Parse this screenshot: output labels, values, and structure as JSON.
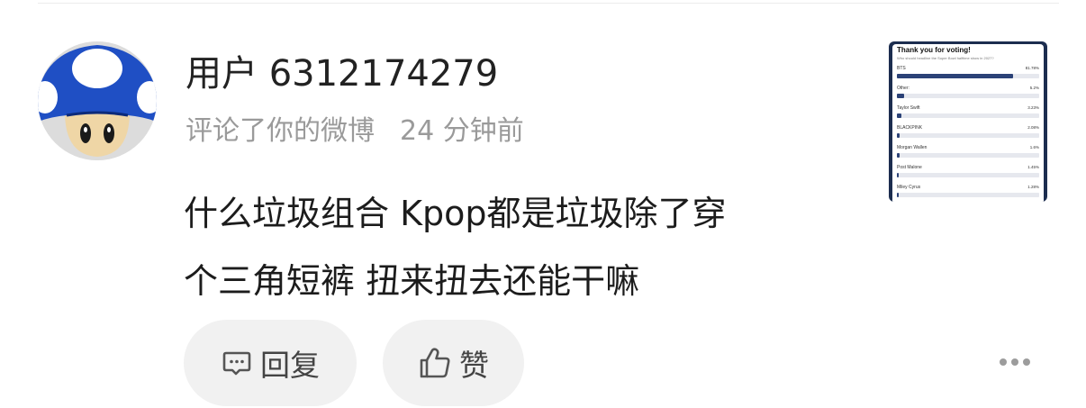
{
  "comment": {
    "username": "用户 6312174279",
    "action": "评论了你的微博",
    "time": "24 分钟前",
    "lines": [
      "什么垃圾组合 Kpop都是垃圾除了穿",
      "个三角短裤 扭来扭去还能干嘛"
    ]
  },
  "thumbnail": {
    "title": "Thank you for voting!",
    "subtitle": "Who should headline the Super Bowl halftime show in 2027?",
    "poll": [
      {
        "name": "BTS",
        "percent": "81.78%",
        "value": 81.78
      },
      {
        "name": "Other:",
        "percent": "5.2%",
        "value": 5.2
      },
      {
        "name": "Taylor Swift",
        "percent": "3.23%",
        "value": 3.23
      },
      {
        "name": "BLACKPINK",
        "percent": "2.08%",
        "value": 2.08
      },
      {
        "name": "Morgan Wallen",
        "percent": "1.6%",
        "value": 1.6
      },
      {
        "name": "Post Malone",
        "percent": "1.45%",
        "value": 1.45
      },
      {
        "name": "Miley Cyrus",
        "percent": "1.28%",
        "value": 1.28
      }
    ]
  },
  "actions": {
    "reply_label": "回复",
    "like_label": "赞"
  },
  "icons": {
    "reply": "comment-icon",
    "like": "thumbs-up-icon",
    "more": "more-icon"
  },
  "colors": {
    "avatar_blue": "#1f4fc4",
    "poll_bar": "#2b4277",
    "button_bg": "#f1f1f1"
  }
}
